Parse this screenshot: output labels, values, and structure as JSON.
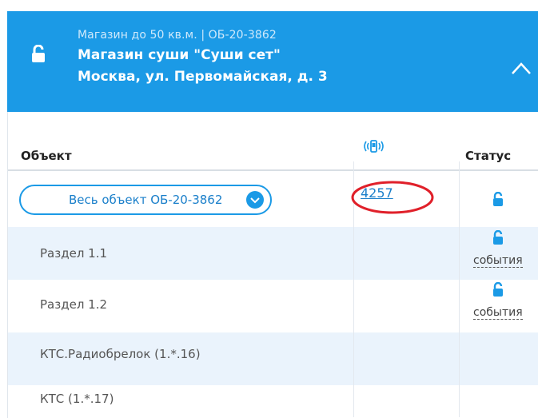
{
  "header": {
    "meta": "Магазин до 50 кв.м.  |  ОБ-20-3862",
    "title": "Магазин суши \"Суши сет\"",
    "address": "Москва, ул. Первомайская, д. 3",
    "bg_color": "#1b9ae6"
  },
  "table": {
    "columns": {
      "object": "Объект",
      "radio_icon": "radio-signal-icon",
      "status": "Статус"
    },
    "main_row": {
      "selector_label": "Весь объект ОБ-20-3862",
      "radio_number": "4257"
    },
    "rows": [
      {
        "label": "Раздел 1.1",
        "events": "события"
      },
      {
        "label": "Раздел 1.2",
        "events": "события"
      },
      {
        "label": "КТС.Радиобрелок (1.*.16)"
      },
      {
        "label": "КТС (1.*.17)"
      }
    ]
  },
  "colors": {
    "accent": "#1b9ae6",
    "row_alt": "#eaf3fc",
    "highlight_oval": "#e0202a"
  }
}
